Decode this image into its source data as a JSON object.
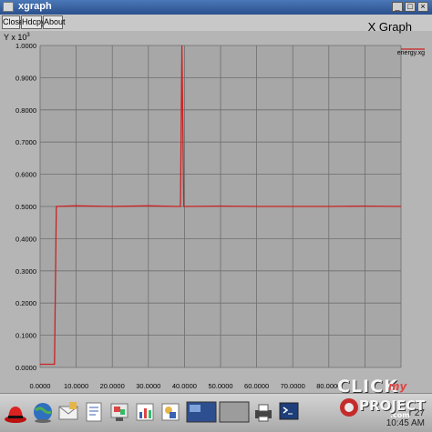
{
  "window": {
    "title": "xgraph",
    "controls": [
      "_",
      "□",
      "×"
    ]
  },
  "toolbar": {
    "buttons": [
      "Close",
      "Hdcpy",
      "About"
    ]
  },
  "graph_title": "X Graph",
  "y_axis_label": "Y x 10",
  "y_axis_exponent": "3",
  "chart_data": {
    "type": "line",
    "title": "X Graph",
    "xlabel": "",
    "ylabel": "Y x 10^3",
    "xlim": [
      0,
      100
    ],
    "ylim": [
      0,
      1
    ],
    "x_ticks": [
      "0.0000",
      "10.0000",
      "20.0000",
      "30.0000",
      "40.0000",
      "50.0000",
      "60.0000",
      "70.0000",
      "80.0000"
    ],
    "y_ticks": [
      "0.0000",
      "0.1000",
      "0.2000",
      "0.3000",
      "0.4000",
      "0.5000",
      "0.6000",
      "0.7000",
      "0.8000",
      "0.9000",
      "1.0000"
    ],
    "grid": true,
    "legend_position": "top-right",
    "series": [
      {
        "name": "energy.xg",
        "color": "#cc2222",
        "x": [
          0,
          4,
          4.5,
          10,
          20,
          30,
          38,
          38.9,
          39.3,
          39.8,
          40.5,
          50,
          60,
          70,
          80,
          90,
          100
        ],
        "y": [
          0.01,
          0.01,
          0.5,
          0.502,
          0.5,
          0.502,
          0.5,
          0.5,
          1.0,
          0.5,
          0.5,
          0.501,
          0.5,
          0.5,
          0.5,
          0.501,
          0.5
        ]
      }
    ]
  },
  "taskbar": {
    "icons": [
      "redhat-icon",
      "globe-icon",
      "mail-icon",
      "writer-icon",
      "impress-icon",
      "calc-icon",
      "draw-icon",
      "workspace1-icon",
      "workspace2-icon",
      "print-icon",
      "camera-icon",
      "terminal-icon"
    ],
    "clock_lines": [
      "r 27",
      "10:45 AM"
    ]
  },
  "branding": [
    "CLICK",
    "my",
    "PROJECT",
    ".com"
  ],
  "colors": {
    "plot_bg": "#a7a7a7",
    "grid": "#6f6f6f",
    "series": "#cc2222",
    "titlebar": "#2a4f8c"
  }
}
